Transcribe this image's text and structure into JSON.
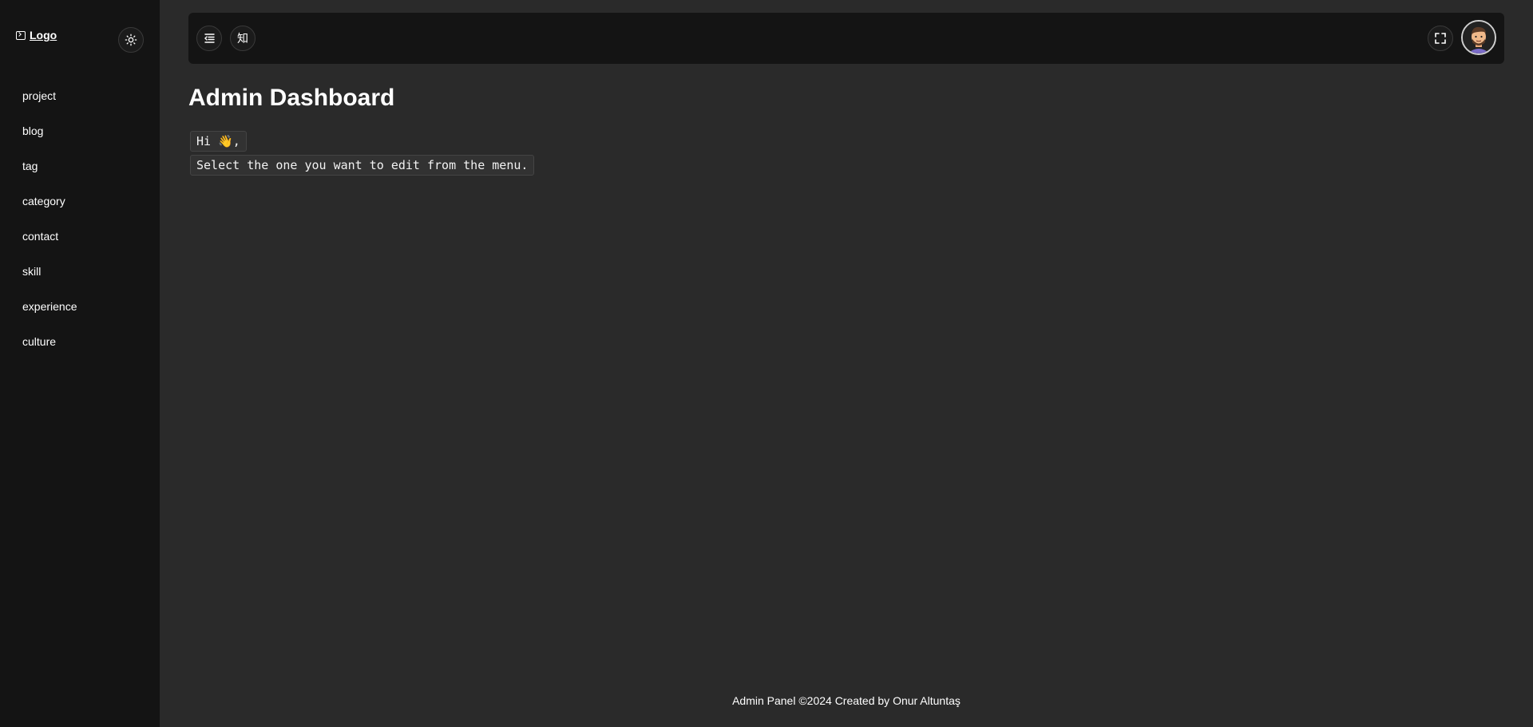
{
  "brand": {
    "label": "Logo",
    "icon": "terminal-icon"
  },
  "theme_toggle": {
    "icon": "sun-icon"
  },
  "sidebar": {
    "items": [
      {
        "label": "project"
      },
      {
        "label": "blog"
      },
      {
        "label": "tag"
      },
      {
        "label": "category"
      },
      {
        "label": "contact"
      },
      {
        "label": "skill"
      },
      {
        "label": "experience"
      },
      {
        "label": "culture"
      }
    ]
  },
  "topbar": {
    "menu_toggle_icon": "menu-collapse-icon",
    "language_label": "知",
    "fullscreen_icon": "fullscreen-icon",
    "avatar_icon": "avatar"
  },
  "main": {
    "title": "Admin Dashboard",
    "greeting": "Hi",
    "greeting_emoji": "👋",
    "greeting_suffix": ",",
    "instruction": "Select the one you want to edit from the menu."
  },
  "footer": {
    "text": "Admin Panel ©2024 Created by Onur Altuntaş"
  },
  "colors": {
    "background": "#2a2a2a",
    "sidebar": "#141414",
    "topbar": "#141414",
    "text": "#ffffff"
  }
}
